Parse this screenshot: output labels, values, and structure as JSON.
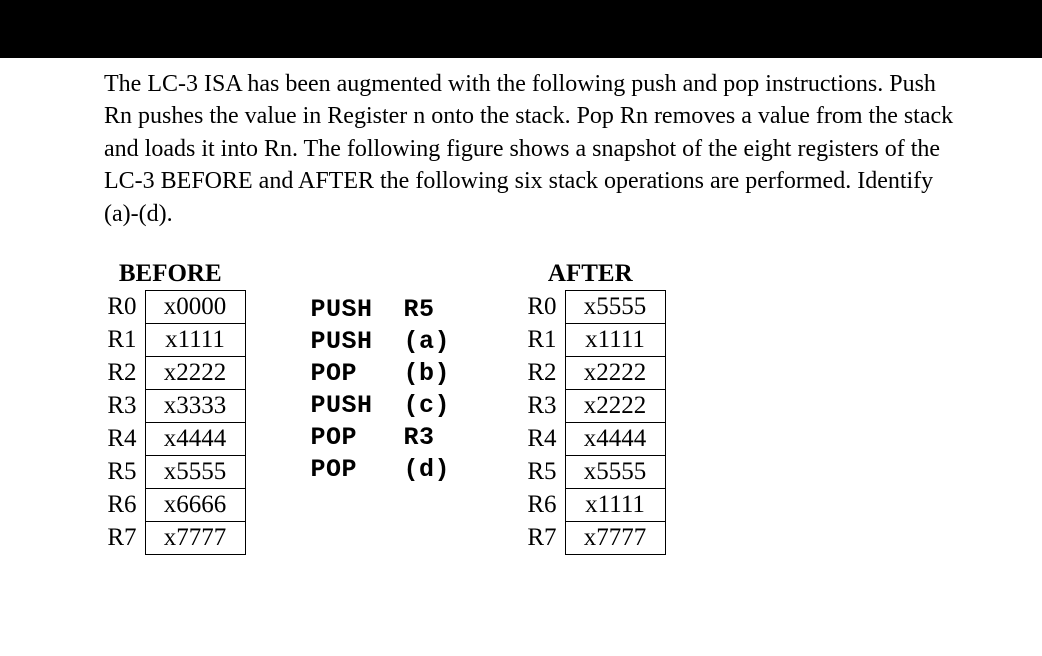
{
  "description": "The LC-3 ISA has been augmented with the following push and pop instructions. Push Rn pushes the value in Register n onto the stack. Pop Rn removes a value from the stack and loads it into Rn. The following figure shows a snapshot of the eight registers of the LC-3 BEFORE and AFTER the following six stack operations are performed. Identify (a)-(d).",
  "before": {
    "title": "BEFORE",
    "rows": [
      {
        "reg": "R0",
        "val": "x0000"
      },
      {
        "reg": "R1",
        "val": "x1111"
      },
      {
        "reg": "R2",
        "val": "x2222"
      },
      {
        "reg": "R3",
        "val": "x3333"
      },
      {
        "reg": "R4",
        "val": "x4444"
      },
      {
        "reg": "R5",
        "val": "x5555"
      },
      {
        "reg": "R6",
        "val": "x6666"
      },
      {
        "reg": "R7",
        "val": "x7777"
      }
    ]
  },
  "after": {
    "title": "AFTER",
    "rows": [
      {
        "reg": "R0",
        "val": "x5555"
      },
      {
        "reg": "R1",
        "val": "x1111"
      },
      {
        "reg": "R2",
        "val": "x2222"
      },
      {
        "reg": "R3",
        "val": "x2222"
      },
      {
        "reg": "R4",
        "val": "x4444"
      },
      {
        "reg": "R5",
        "val": "x5555"
      },
      {
        "reg": "R6",
        "val": "x1111"
      },
      {
        "reg": "R7",
        "val": "x7777"
      }
    ]
  },
  "operations": [
    {
      "op": "PUSH",
      "arg": "R5"
    },
    {
      "op": "PUSH",
      "arg": "(a)"
    },
    {
      "op": "POP",
      "arg": "(b)"
    },
    {
      "op": "PUSH",
      "arg": "(c)"
    },
    {
      "op": "POP",
      "arg": "R3"
    },
    {
      "op": "POP",
      "arg": "(d)"
    }
  ]
}
